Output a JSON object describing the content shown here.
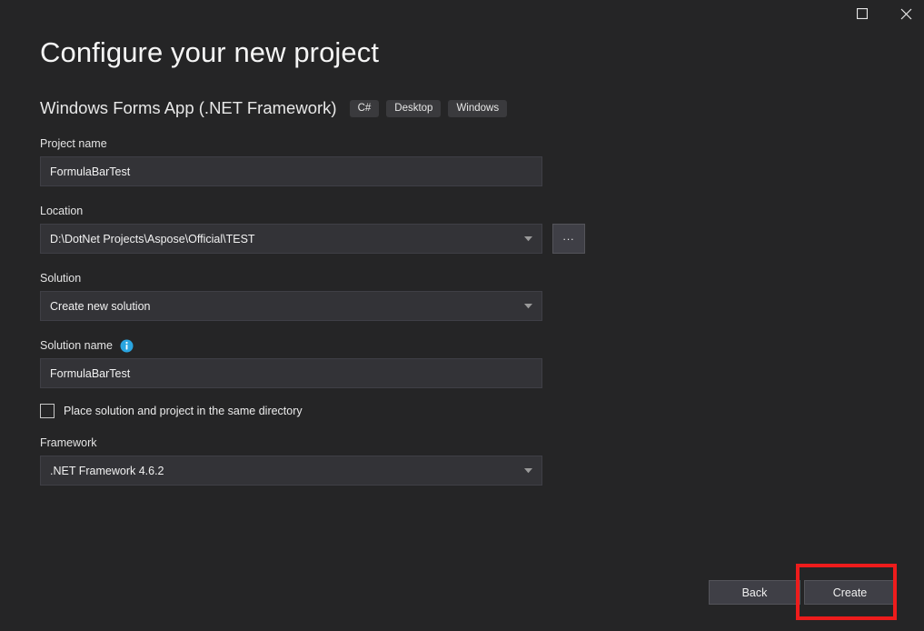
{
  "window": {
    "maximize_icon": "maximize-icon",
    "close_icon": "close-icon"
  },
  "header": {
    "title": "Configure your new project",
    "subtitle": "Windows Forms App (.NET Framework)",
    "tags": [
      "C#",
      "Desktop",
      "Windows"
    ]
  },
  "form": {
    "project_name": {
      "label": "Project name",
      "value": "FormulaBarTest"
    },
    "location": {
      "label": "Location",
      "value": "D:\\DotNet Projects\\Aspose\\Official\\TEST",
      "browse_label": "...",
      "browse_icon": "ellipsis-icon",
      "dropdown_icon": "chevron-down-icon"
    },
    "solution": {
      "label": "Solution",
      "value": "Create new solution",
      "dropdown_icon": "chevron-down-icon"
    },
    "solution_name": {
      "label": "Solution name",
      "info_icon": "info-icon",
      "value": "FormulaBarTest"
    },
    "same_directory": {
      "label": "Place solution and project in the same directory",
      "checked": false
    },
    "framework": {
      "label": "Framework",
      "value": ".NET Framework 4.6.2",
      "dropdown_icon": "chevron-down-icon"
    }
  },
  "footer": {
    "back_label": "Back",
    "create_label": "Create"
  },
  "annotation": {
    "highlight_color": "#ee1c1c",
    "target": "create-button"
  },
  "colors": {
    "background": "#252526",
    "field_background": "#333337",
    "field_border": "#3f3f46",
    "button_background": "#3f3f46",
    "button_border": "#54545a",
    "tag_background": "#3a3a3d",
    "info_blue": "#2aa5e0",
    "text": "#f0f0f0"
  }
}
